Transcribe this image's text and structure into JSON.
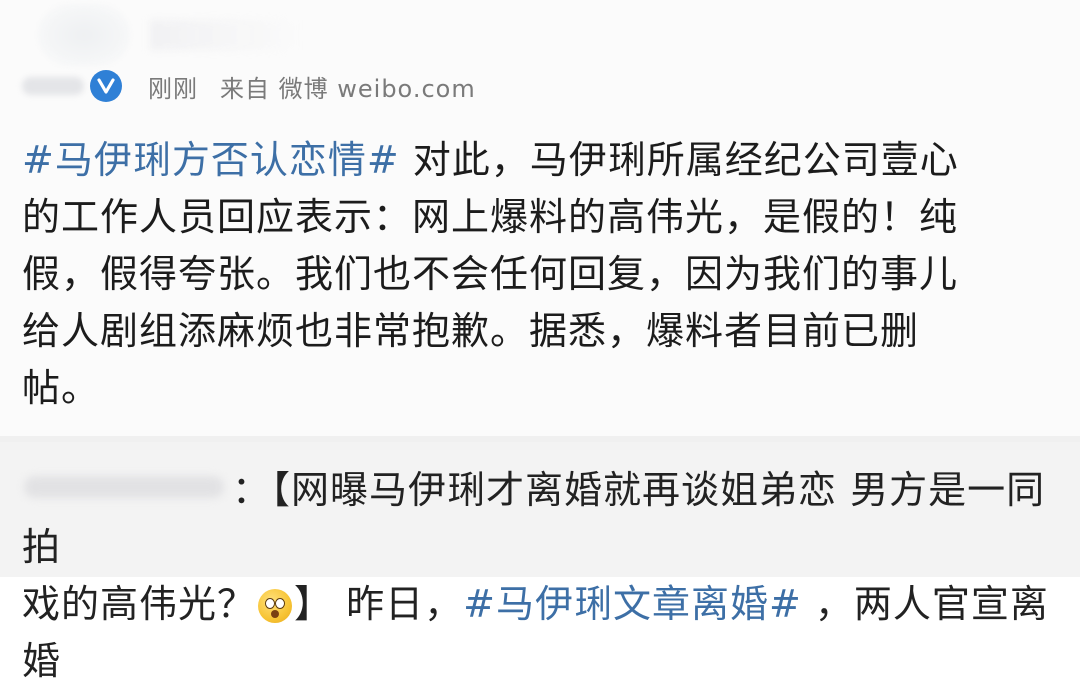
{
  "header": {
    "time": "刚刚",
    "source": "来自 微博 weibo.com",
    "verified_icon": "verified-v-icon",
    "verified_color": "#2f80d6"
  },
  "post": {
    "hashtag": "#马伊琍方否认恋情#",
    "line1_rest": " 对此，马伊琍所属经纪公司壹心",
    "line2": "的工作人员回应表示：网上爆料的高伟光，是假的！纯",
    "line3": "假，假得夸张。我们也不会任何回复，因为我们的事儿",
    "line4": "给人剧组添麻烦也非常抱歉。据悉，爆料者目前已删",
    "line5": "帖。"
  },
  "repost": {
    "line1": "：【网曝马伊琍才离婚就再谈姐弟恋 男方是一同拍",
    "line2_a": "戏的高伟光？",
    "emoji": "surprised-face-emoji",
    "line2_b": "】 昨日，",
    "hashtag": "#马伊琍文章离婚#",
    "line2_c": " ，两人官宣离婚"
  },
  "colors": {
    "hashtag": "#3d6fa6",
    "text": "#1c1c1c",
    "meta": "#7a7a7a"
  }
}
